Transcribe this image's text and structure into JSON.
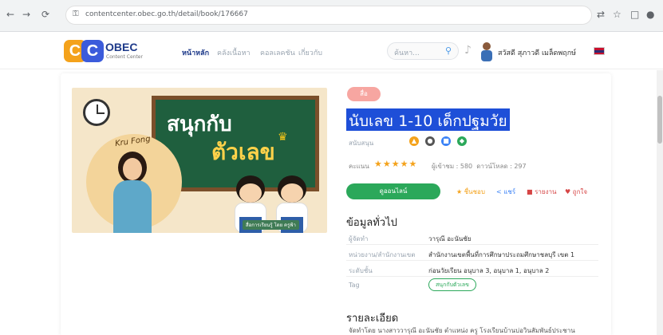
{
  "browser": {
    "back": "←",
    "forward": "→",
    "reload": "⟳",
    "url": "contentcenter.obec.go.th/detail/book/176667"
  },
  "site": {
    "logo_brand": "OBEC",
    "logo_sub": "Content Center",
    "menu": [
      "หน้าหลัก",
      "คลังเนื้อหา",
      "คอลเลคชัน",
      "เกี่ยวกับ"
    ],
    "search_placeholder": "ค้นหา...",
    "user_name": "สวัสดี สุภาวดี เมล็ดพฤกษ์"
  },
  "hero": {
    "board_line1": "สนุกกับ",
    "board_line2": "ตัวเลข",
    "kru": "Kru Fong",
    "credit": "สื่อการเรียนรู้ โดย ครูฟ้า"
  },
  "detail": {
    "badge": "สื่อ",
    "title": "นับเลข 1-10 เด็กปฐมวัย",
    "subject_label": "สนับสนุน",
    "rating_label": "คะแนน",
    "stars": "★★★★★",
    "views_label": "ผู้เข้าชม : 580",
    "downloads_label": "ดาวน์โหลด : 297",
    "download_button": "ดูออนไลน์",
    "actions": {
      "favorite": "ชื่นชอบ",
      "share": "แชร์",
      "report": "รายงาน",
      "like": "ถูกใจ"
    },
    "general_heading": "ข้อมูลทั่วไป",
    "fields": [
      {
        "key": "ผู้จัดทำ",
        "value": "วารุณี อะนันชัย"
      },
      {
        "key": "หน่วยงาน/สำนักงานเขต",
        "value": "สำนักงานเขตพื้นที่การศึกษาประถมศึกษาชลบุรี เขต 1"
      },
      {
        "key": "ระดับชั้น",
        "value": "ก่อนวัยเรียน อนุบาล 3, อนุบาล 1, อนุบาล 2"
      },
      {
        "key": "Tag",
        "value": ""
      }
    ],
    "tag_value": "สนุกกับตัวเลข",
    "detail_heading": "รายละเอียด",
    "description": "จัดทำโดย นางสาววารุณี อะนันชัย ตำแหน่ง ครู โรงเรียนบ้านบ่อวินสัมพันธ์ประชาน"
  },
  "colors": {
    "title_bg": "#1e4fd8",
    "download_green": "#2ba85a",
    "badge_pink": "#f7a6a1",
    "logo_orange": "#f4a21b",
    "logo_blue": "#3b5bdb"
  }
}
